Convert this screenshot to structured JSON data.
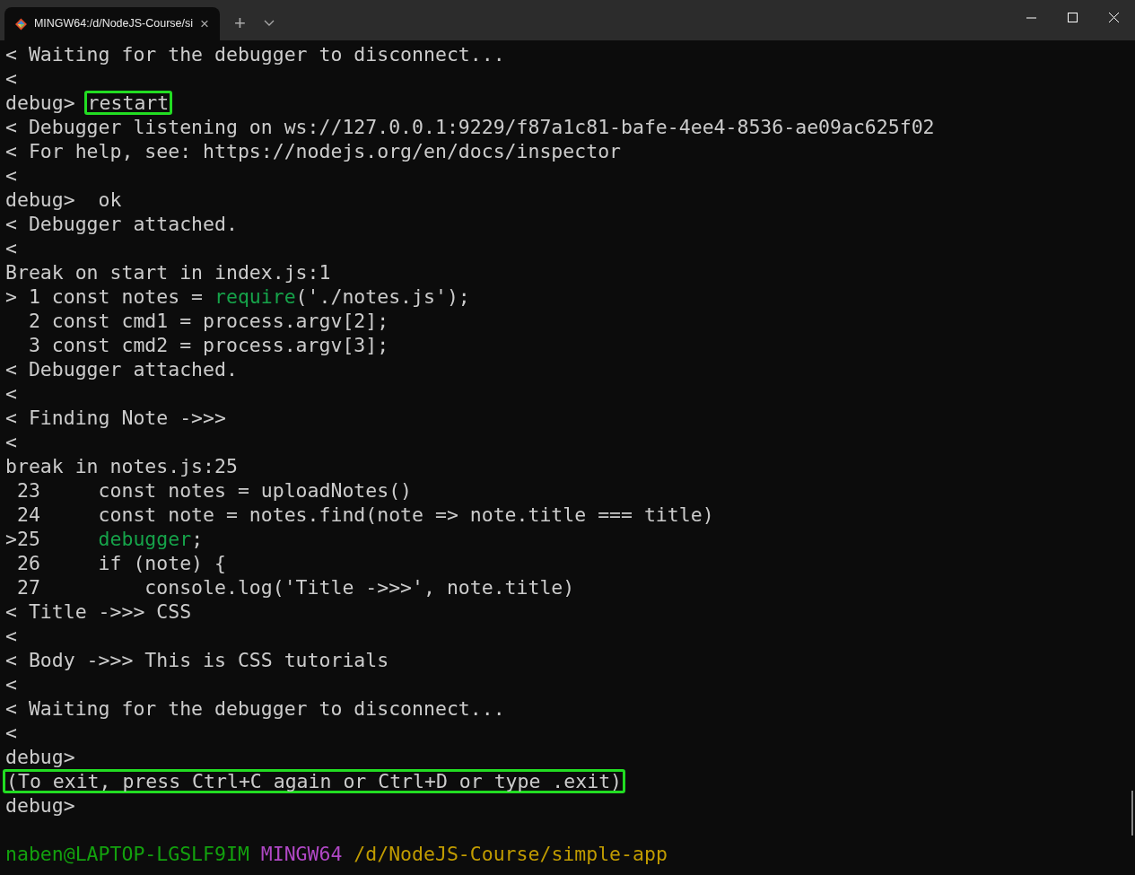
{
  "tab": {
    "title": "MINGW64:/d/NodeJS-Course/si",
    "close": "×",
    "new_tab": "+",
    "selected": true
  },
  "lines": [
    {
      "parts": [
        {
          "text": "< Waiting for the debugger to disconnect...",
          "kind": "plain"
        }
      ]
    },
    {
      "parts": [
        {
          "text": "<",
          "kind": "plain"
        }
      ]
    },
    {
      "parts": [
        {
          "text": "debug> ",
          "kind": "plain"
        },
        {
          "text": "restart",
          "kind": "boxed"
        }
      ]
    },
    {
      "parts": [
        {
          "text": "< Debugger listening on ws://127.0.0.1:9229/f87a1c81-bafe-4ee4-8536-ae09ac625f02",
          "kind": "plain"
        }
      ]
    },
    {
      "parts": [
        {
          "text": "< For help, see: https://nodejs.org/en/docs/inspector",
          "kind": "plain"
        }
      ]
    },
    {
      "parts": [
        {
          "text": "<",
          "kind": "plain"
        }
      ]
    },
    {
      "parts": [
        {
          "text": "debug>  ok",
          "kind": "plain"
        }
      ]
    },
    {
      "parts": [
        {
          "text": "< Debugger attached.",
          "kind": "plain"
        }
      ]
    },
    {
      "parts": [
        {
          "text": "<",
          "kind": "plain"
        }
      ]
    },
    {
      "parts": [
        {
          "text": "Break on start in index.js:1",
          "kind": "plain"
        }
      ]
    },
    {
      "parts": [
        {
          "text": "> 1 const notes = ",
          "kind": "plain"
        },
        {
          "text": "require",
          "kind": "keyword"
        },
        {
          "text": "('./notes.js');",
          "kind": "plain"
        }
      ]
    },
    {
      "parts": [
        {
          "text": "  2 const cmd1 = process.argv[2];",
          "kind": "plain"
        }
      ]
    },
    {
      "parts": [
        {
          "text": "  3 const cmd2 = process.argv[3];",
          "kind": "plain"
        }
      ]
    },
    {
      "parts": [
        {
          "text": "< Debugger attached.",
          "kind": "plain"
        }
      ]
    },
    {
      "parts": [
        {
          "text": "<",
          "kind": "plain"
        }
      ]
    },
    {
      "parts": [
        {
          "text": "< Finding Note ->>>",
          "kind": "plain"
        }
      ]
    },
    {
      "parts": [
        {
          "text": "<",
          "kind": "plain"
        }
      ]
    },
    {
      "parts": [
        {
          "text": "break in notes.js:25",
          "kind": "plain"
        }
      ]
    },
    {
      "parts": [
        {
          "text": " 23     const notes = uploadNotes()",
          "kind": "plain"
        }
      ]
    },
    {
      "parts": [
        {
          "text": " 24     const note = notes.find(note => note.title === title)",
          "kind": "plain"
        }
      ]
    },
    {
      "parts": [
        {
          "text": ">25     ",
          "kind": "plain"
        },
        {
          "text": "debugger",
          "kind": "keyword"
        },
        {
          "text": ";",
          "kind": "plain"
        }
      ]
    },
    {
      "parts": [
        {
          "text": " 26     if (note) {",
          "kind": "plain"
        }
      ]
    },
    {
      "parts": [
        {
          "text": " 27         console.log('Title ->>>', note.title)",
          "kind": "plain"
        }
      ]
    },
    {
      "parts": [
        {
          "text": "< Title ->>> CSS",
          "kind": "plain"
        }
      ]
    },
    {
      "parts": [
        {
          "text": "<",
          "kind": "plain"
        }
      ]
    },
    {
      "parts": [
        {
          "text": "< Body ->>> This is CSS tutorials",
          "kind": "plain"
        }
      ]
    },
    {
      "parts": [
        {
          "text": "<",
          "kind": "plain"
        }
      ]
    },
    {
      "parts": [
        {
          "text": "< Waiting for the debugger to disconnect...",
          "kind": "plain"
        }
      ]
    },
    {
      "parts": [
        {
          "text": "<",
          "kind": "plain"
        }
      ]
    },
    {
      "parts": [
        {
          "text": "debug>",
          "kind": "plain"
        }
      ]
    },
    {
      "parts": [
        {
          "text": "(To exit, press Ctrl+C again or Ctrl+D or type .exit)",
          "kind": "boxed"
        }
      ]
    },
    {
      "parts": [
        {
          "text": "debug>",
          "kind": "plain"
        }
      ]
    }
  ],
  "prompt": {
    "parts": [
      {
        "text": "naben@LAPTOP-LGSLF9IM ",
        "kind": "user"
      },
      {
        "text": "MINGW64 ",
        "kind": "host"
      },
      {
        "text": "/d/NodeJS-Course/simple-app",
        "kind": "path"
      }
    ]
  }
}
